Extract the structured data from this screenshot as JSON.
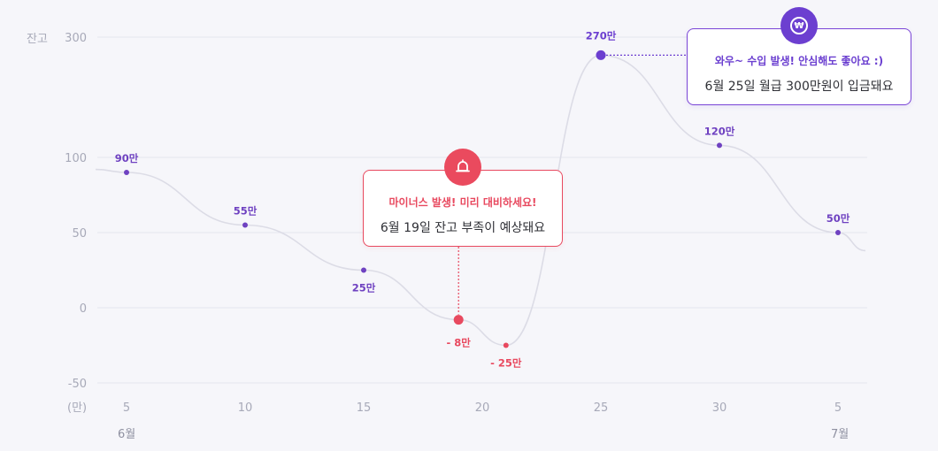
{
  "chart_data": {
    "type": "line",
    "ylabel": "잔고",
    "unit_label": "(만)",
    "y_ticks": [
      300,
      100,
      50,
      0,
      -50
    ],
    "x_ticks": [
      "5",
      "10",
      "15",
      "20",
      "25",
      "30",
      "5"
    ],
    "month_labels": [
      "6월",
      "7월"
    ],
    "series": [
      {
        "points": [
          {
            "x": "6/5",
            "y": 90,
            "label": "90만"
          },
          {
            "x": "6/10",
            "y": 55,
            "label": "55만"
          },
          {
            "x": "6/15",
            "y": 25,
            "label": "25만"
          },
          {
            "x": "6/19",
            "y": -8,
            "label": "- 8만",
            "highlight": "minus"
          },
          {
            "x": "6/21",
            "y": -25,
            "label": "- 25만"
          },
          {
            "x": "6/25",
            "y": 270,
            "label": "270만",
            "highlight": "income"
          },
          {
            "x": "6/30",
            "y": 120,
            "label": "120만"
          },
          {
            "x": "7/5",
            "y": 50,
            "label": "50만"
          }
        ]
      }
    ],
    "colors": {
      "line": "#dcdce6",
      "point": "#6f42c1",
      "minus": "#e8495f",
      "income": "#6c3fd0",
      "grid": "#e4e5ee"
    }
  },
  "alerts": {
    "minus": {
      "icon": "bell-icon",
      "title": "마이너스 발생! 미리 대비하세요!",
      "message": "6월 19일 잔고 부족이 예상돼요"
    },
    "income": {
      "icon": "won-icon",
      "icon_text": "₩",
      "title": "와우~ 수입 발생! 안심해도 좋아요 :)",
      "message": "6월 25일 월급 300만원이 입금돼요"
    }
  }
}
